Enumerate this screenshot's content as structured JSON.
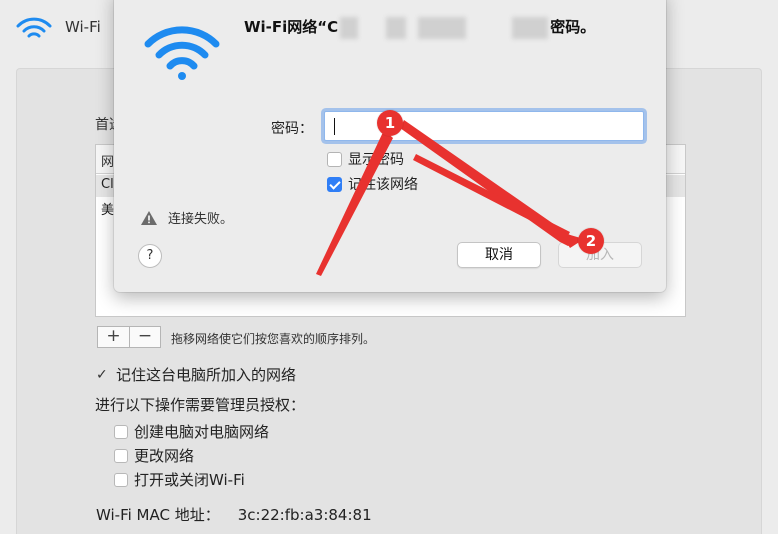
{
  "window": {
    "title": "Wi-Fi"
  },
  "preferences": {
    "preferred_label": "首选",
    "table_header": "网",
    "rows": [
      "Cl",
      "美"
    ],
    "plus": "+",
    "minus": "−",
    "drag_hint": "拖移网络使它们按您喜欢的顺序排列。",
    "remember_networks": "记住这台电脑所加入的网络",
    "admin_label": "进行以下操作需要管理员授权：",
    "admin_options": [
      "创建电脑对电脑网络",
      "更改网络",
      "打开或关闭Wi-Fi"
    ],
    "mac_label": "Wi-Fi MAC 地址：",
    "mac_value": "3c:22:fb:a3:84:81"
  },
  "dialog": {
    "title_prefix": "Wi-Fi网络“",
    "title_visible_fragment": "C",
    "title_suffix": "密码。",
    "password_label": "密码：",
    "password_value": "",
    "show_password": "显示密码",
    "show_password_checked": false,
    "remember_network": "记住该网络",
    "remember_network_checked": true,
    "failure_message": "连接失败。",
    "help": "?",
    "cancel": "取消",
    "join": "加入"
  },
  "annotations": [
    {
      "label": "1",
      "color": "#e8322f"
    },
    {
      "label": "2",
      "color": "#e8322f"
    }
  ],
  "colors": {
    "accent": "#2f7ef6",
    "annotation": "#e8322f",
    "wifi_blue": "#1e8bf0"
  }
}
